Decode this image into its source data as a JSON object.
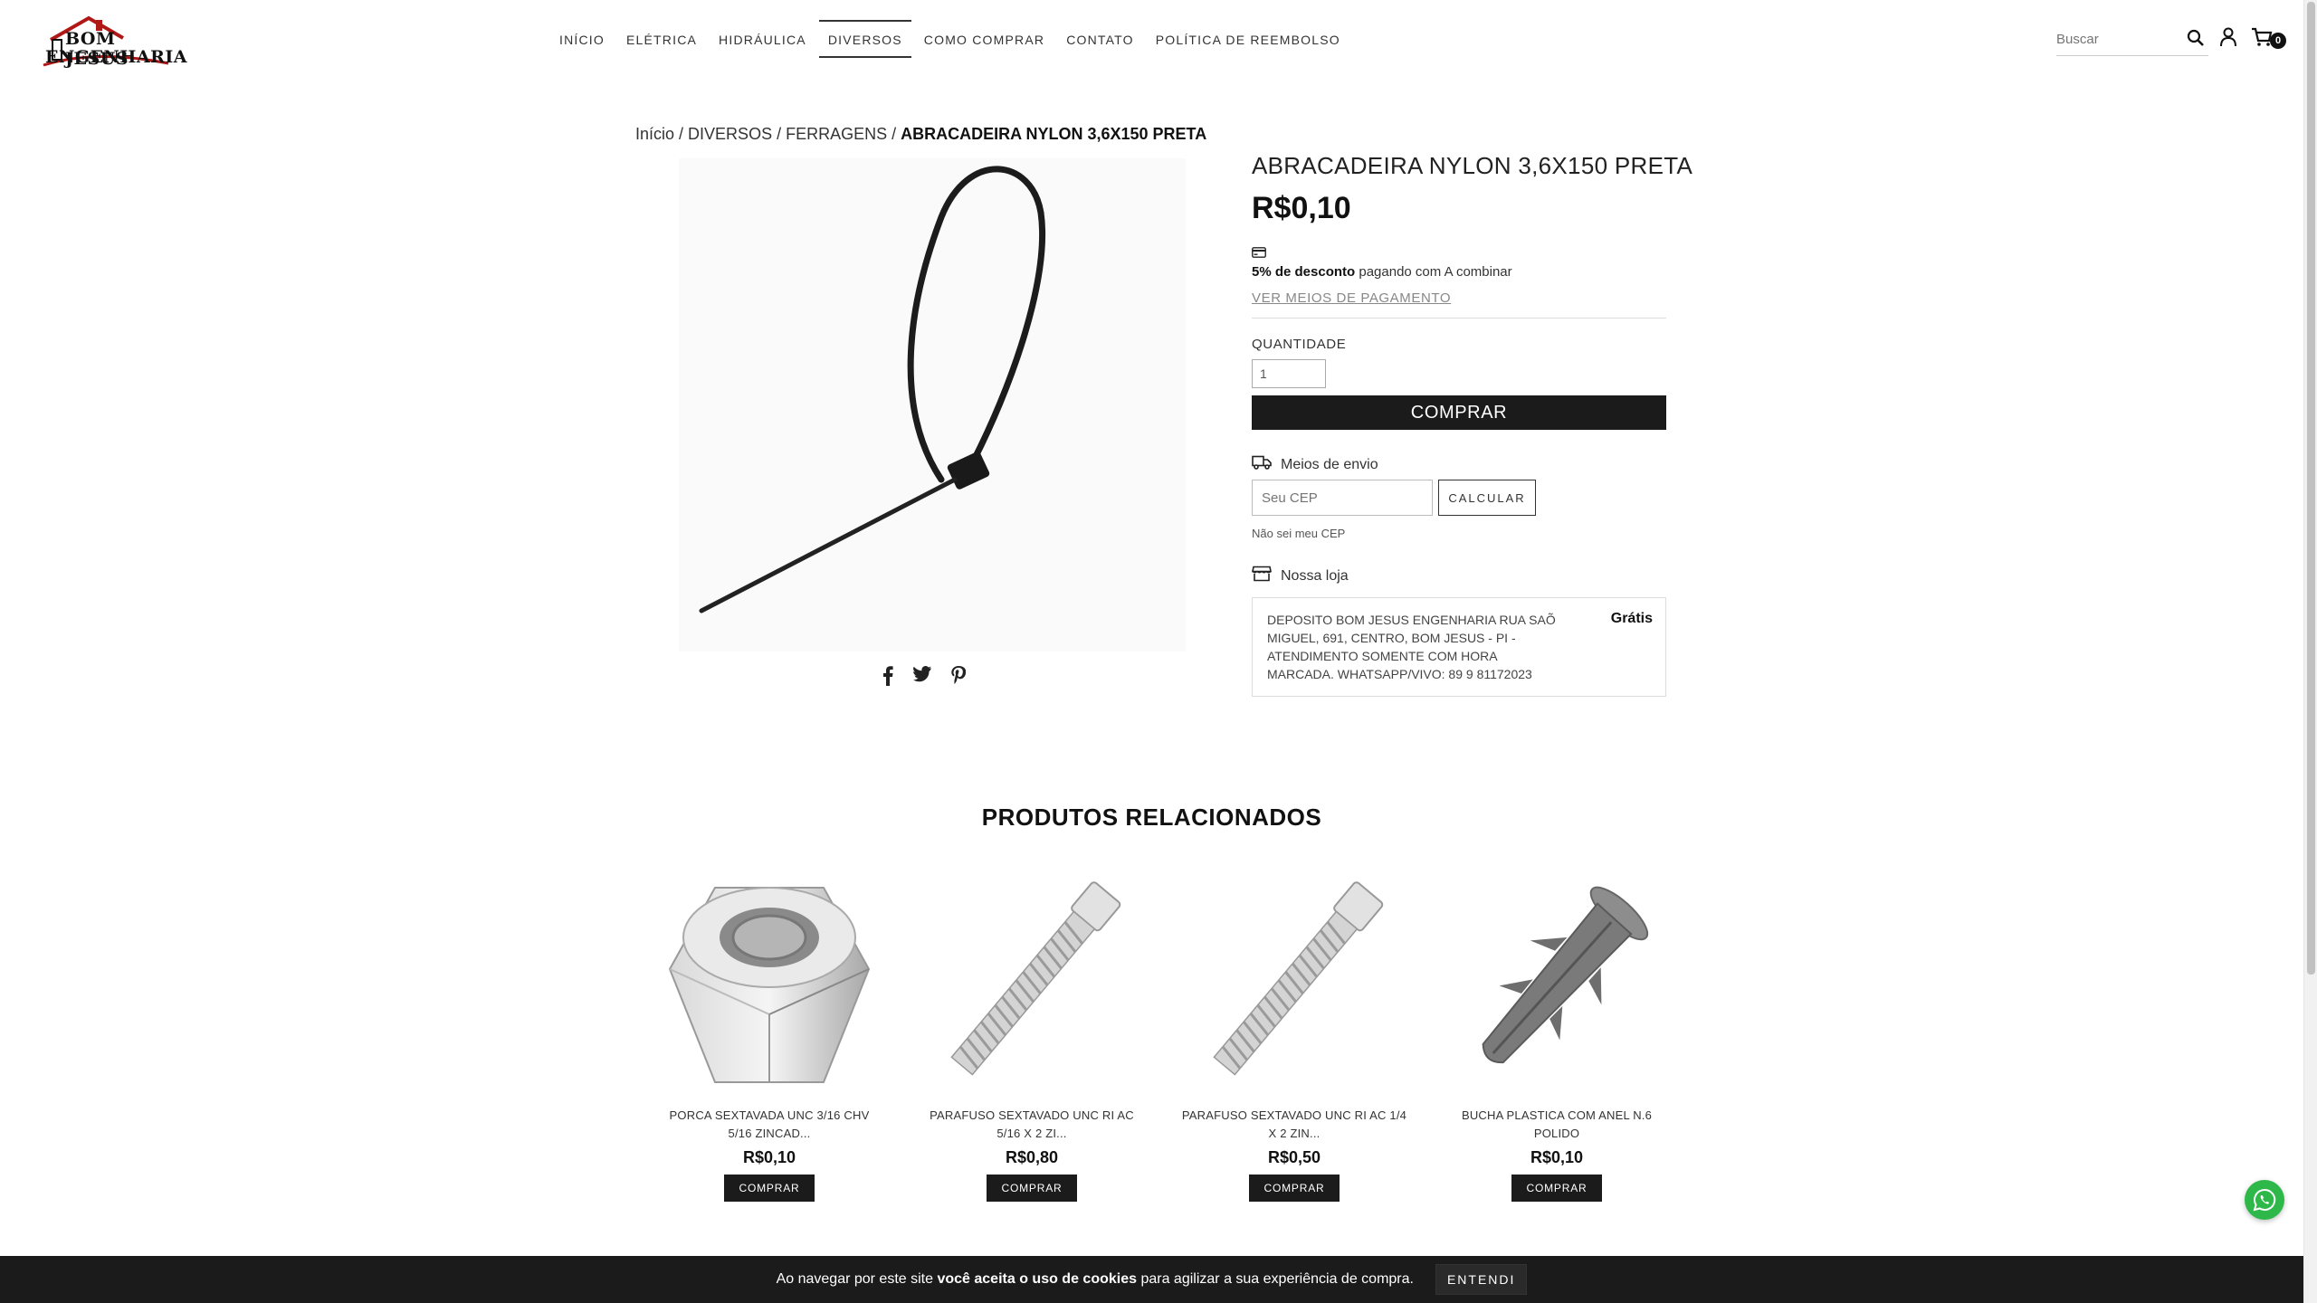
{
  "brand": {
    "line1": "BOM JESUS",
    "line2": "ENGENHARIA"
  },
  "nav": [
    {
      "label": "INÍCIO"
    },
    {
      "label": "ELÉTRICA"
    },
    {
      "label": "HIDRÁULICA"
    },
    {
      "label": "DIVERSOS"
    },
    {
      "label": "COMO COMPRAR"
    },
    {
      "label": "CONTATO"
    },
    {
      "label": "POLÍTICA DE REEMBOLSO"
    }
  ],
  "search": {
    "placeholder": "Buscar"
  },
  "cart": {
    "count": "0"
  },
  "breadcrumb": {
    "home": "Início",
    "sep": " / ",
    "cat": "DIVERSOS",
    "sub": "FERRAGENS",
    "current": "ABRACADEIRA NYLON 3,6X150 PRETA"
  },
  "product": {
    "title": "ABRACADEIRA NYLON 3,6X150 PRETA",
    "price": "R$0,10",
    "discount_bold": "5% de desconto",
    "discount_rest": " pagando com A combinar",
    "payment_link": "VER MEIOS DE PAGAMENTO",
    "qty_label": "QUANTIDADE",
    "qty_value": "1",
    "buy_label": "COMPRAR"
  },
  "shipping": {
    "label": "Meios de envio",
    "cep_placeholder": "Seu CEP",
    "calc_label": "CALCULAR",
    "no_cep": "Não sei meu CEP",
    "store_label": "Nossa loja",
    "store_text": "DEPOSITO BOM JESUS ENGENHARIA  RUA SAÕ MIGUEL, 691, CENTRO, BOM JESUS - PI - ATENDIMENTO SOMENTE COM HORA MARCADA. WHATSAPP/VIVO: 89 9 81172023",
    "store_price": "Grátis"
  },
  "related": {
    "title": "PRODUTOS RELACIONADOS",
    "items": [
      {
        "name": "PORCA SEXTAVADA UNC 3/16 CHV 5/16 ZINCAD...",
        "price": "R$0,10",
        "button": "COMPRAR"
      },
      {
        "name": "PARAFUSO SEXTAVADO UNC RI AC 5/16 X 2 ZI...",
        "price": "R$0,80",
        "button": "COMPRAR"
      },
      {
        "name": "PARAFUSO SEXTAVADO UNC RI AC 1/4 X 2 ZIN...",
        "price": "R$0,50",
        "button": "COMPRAR"
      },
      {
        "name": "BUCHA PLASTICA COM ANEL N.6 POLIDO",
        "price": "R$0,10",
        "button": "COMPRAR"
      }
    ]
  },
  "cookie": {
    "pre": "Ao navegar por este site ",
    "bold": "você aceita o uso de cookies",
    "post": " para agilizar a sua experiência de compra.",
    "button": "ENTENDI"
  }
}
